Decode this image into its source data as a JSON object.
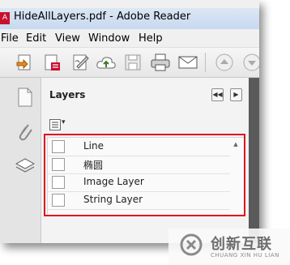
{
  "window": {
    "title": "HideAllLayers.pdf - Adobe Reader"
  },
  "menu": {
    "items": [
      "File",
      "Edit",
      "View",
      "Window",
      "Help"
    ]
  },
  "toolbar": {
    "buttons": [
      "open-icon",
      "create-pdf-icon",
      "sign-icon",
      "upload-icon",
      "save-icon",
      "print-icon",
      "email-icon",
      "previous-page-icon",
      "next-page-icon"
    ]
  },
  "left_rail": {
    "buttons": [
      "pages-icon",
      "attachments-icon",
      "layers-icon"
    ]
  },
  "panel": {
    "title": "Layers",
    "collapse_glyph": "◀◀",
    "next_glyph": "▶",
    "options_glyph": "▾"
  },
  "layers": {
    "items": [
      {
        "label": "Line",
        "visible": false
      },
      {
        "label": "椭圆",
        "visible": false
      },
      {
        "label": "Image Layer",
        "visible": false
      },
      {
        "label": "String Layer",
        "visible": false
      }
    ],
    "scroll_up_glyph": "▲"
  },
  "colors": {
    "highlight": "#e0141e",
    "title_bar": "#c7d9ee",
    "adobe_red": "#c8102e"
  },
  "watermark": {
    "text": "创新互联",
    "subtitle": "CHUANG XIN HU LIAN"
  }
}
